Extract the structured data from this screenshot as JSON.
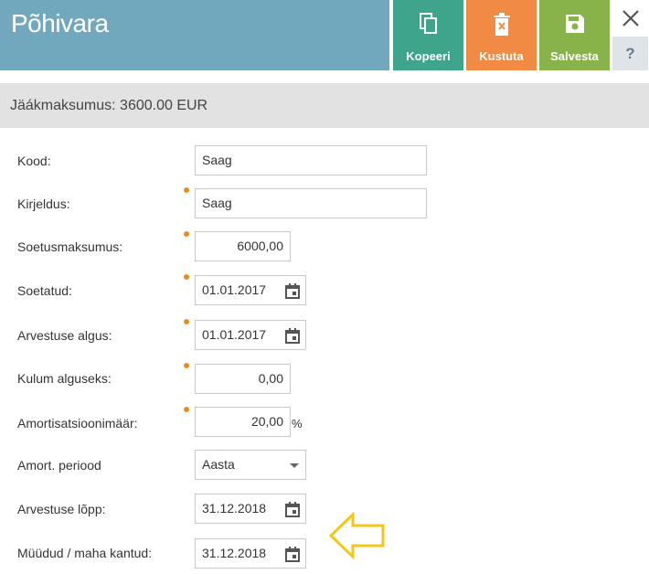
{
  "header": {
    "title": "Põhivara"
  },
  "toolbar": {
    "copy_label": "Kopeeri",
    "delete_label": "Kustuta",
    "save_label": "Salvesta",
    "close_icon": "close-icon",
    "help_label": "?"
  },
  "balance": {
    "text": "Jäákmaksumus: 3600.00 EUR"
  },
  "form": {
    "code": {
      "label": "Kood:",
      "value": "Saag"
    },
    "description": {
      "label": "Kirjeldus:",
      "value": "Saag"
    },
    "acquisition_cost": {
      "label": "Soetusmaksumus:",
      "value": "6000,00"
    },
    "acquired": {
      "label": "Soetatud:",
      "value": "01.01.2017"
    },
    "accounting_start": {
      "label": "Arvestuse algus:",
      "value": "01.01.2017"
    },
    "initial_depreciation": {
      "label": "Kulum alguseks:",
      "value": "0,00"
    },
    "depreciation_rate": {
      "label": "Amortisatsioonimäär:",
      "value": "20,00",
      "unit": "%"
    },
    "depreciation_period": {
      "label": "Amort. periood",
      "value": "Aasta"
    },
    "accounting_end": {
      "label": "Arvestuse lõpp:",
      "value": "31.12.2018"
    },
    "sold_written_off": {
      "label": "Müüdud / maha kantud:",
      "value": "31.12.2018"
    }
  },
  "colors": {
    "header": "#72a8be",
    "copy": "#3fa48c",
    "delete": "#f08a45",
    "save": "#88b24a",
    "required_dot": "#f08a20",
    "annotation_arrow": "#f5c518"
  }
}
